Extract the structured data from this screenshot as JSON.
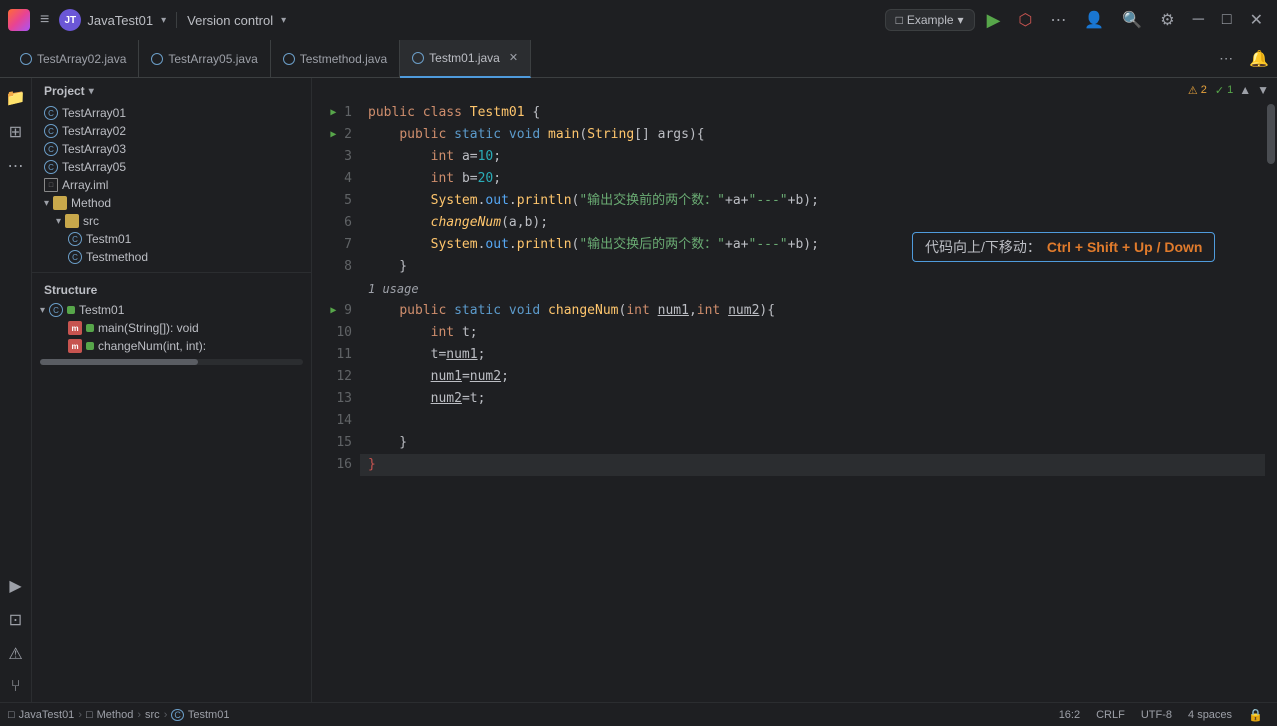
{
  "titlebar": {
    "logo": "JT",
    "hamburger": "≡",
    "project_name": "JavaTest01",
    "vcs": "Version control",
    "example_tab": "Example",
    "run_icon": "▶",
    "debug_icon": "🐛",
    "more_icon": "⋯",
    "profile_icon": "👤",
    "search_icon": "🔍",
    "settings_icon": "⚙"
  },
  "tabs": [
    {
      "label": "TestArray02.java",
      "active": false,
      "closable": false
    },
    {
      "label": "TestArray05.java",
      "active": false,
      "closable": false
    },
    {
      "label": "Testmethod.java",
      "active": false,
      "closable": false
    },
    {
      "label": "Testm01.java",
      "active": true,
      "closable": true
    }
  ],
  "sidebar": {
    "project_header": "Project",
    "items": [
      {
        "label": "TestArray01",
        "type": "c",
        "indent": 1
      },
      {
        "label": "TestArray02",
        "type": "c",
        "indent": 1
      },
      {
        "label": "TestArray03",
        "type": "c",
        "indent": 1
      },
      {
        "label": "TestArray05",
        "type": "c",
        "indent": 1
      },
      {
        "label": "Array.iml",
        "type": "file",
        "indent": 1
      },
      {
        "label": "Method",
        "type": "folder",
        "indent": 1
      },
      {
        "label": "src",
        "type": "folder",
        "indent": 2
      },
      {
        "label": "Testm01",
        "type": "c",
        "indent": 3
      },
      {
        "label": "Testmethod",
        "type": "c",
        "indent": 3
      }
    ],
    "structure_header": "Structure",
    "structure_items": [
      {
        "label": "Testm01",
        "type": "class",
        "indent": 0
      },
      {
        "label": "main(String[]): void",
        "type": "method",
        "indent": 1
      },
      {
        "label": "changeNum(int, int):",
        "type": "method",
        "indent": 1
      }
    ]
  },
  "editor": {
    "filename": "Testm01.java",
    "warnings": "2",
    "checks": "1",
    "cursor_pos": "16:2",
    "line_ending": "CRLF",
    "encoding": "UTF-8",
    "indent": "4 spaces",
    "tooltip": "代码向上/下移动：Ctrl + Shift + Up / Down",
    "usage_hint": "1 usage",
    "lines": [
      {
        "num": 1,
        "run": true,
        "code": "public class Testm01 {"
      },
      {
        "num": 2,
        "run": true,
        "code": "    public static void main(String[] args){"
      },
      {
        "num": 3,
        "run": false,
        "code": "        int a=10;"
      },
      {
        "num": 4,
        "run": false,
        "code": "        int b=20;"
      },
      {
        "num": 5,
        "run": false,
        "code": "        System.out.println(\"输出交换前的两个数：\"+a+\"---\"+b);"
      },
      {
        "num": 6,
        "run": false,
        "code": "        changeNum(a,b);"
      },
      {
        "num": 7,
        "run": false,
        "code": "        System.out.println(\"输出交换后的两个数：\"+a+\"---\"+b);"
      },
      {
        "num": 8,
        "run": false,
        "code": "    }"
      },
      {
        "num": 9,
        "run": true,
        "code": "    public static void changeNum(int num1,int num2){"
      },
      {
        "num": 10,
        "run": false,
        "code": "        int t;"
      },
      {
        "num": 11,
        "run": false,
        "code": "        t=num1;"
      },
      {
        "num": 12,
        "run": false,
        "code": "        num1=num2;"
      },
      {
        "num": 13,
        "run": false,
        "code": "        num2=t;"
      },
      {
        "num": 14,
        "run": false,
        "code": ""
      },
      {
        "num": 15,
        "run": false,
        "code": "    }"
      },
      {
        "num": 16,
        "run": false,
        "code": "}"
      }
    ]
  },
  "statusbar": {
    "project": "JavaTest01",
    "method": "Method",
    "src": "src",
    "class": "Testm01",
    "cursor": "16:2",
    "line_ending": "CRLF",
    "encoding": "UTF-8",
    "indent": "4 spaces"
  },
  "left_icons": [
    "📁",
    "🔲",
    "⋯",
    "▶",
    "⊡",
    "⚠"
  ]
}
